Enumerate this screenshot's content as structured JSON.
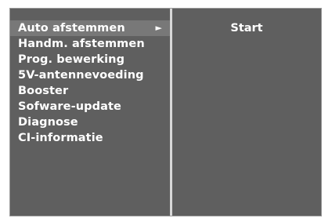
{
  "menu": {
    "items": [
      {
        "label": "Auto afstemmen",
        "selected": true
      },
      {
        "label": "Handm. afstemmen"
      },
      {
        "label": "Prog. bewerking"
      },
      {
        "label": "5V-antennevoeding"
      },
      {
        "label": "Booster"
      },
      {
        "label": "Sofware-update"
      },
      {
        "label": "Diagnose"
      },
      {
        "label": "CI-informatie"
      }
    ],
    "submenu_arrow": "►"
  },
  "submenu": {
    "option": "Start"
  },
  "colors": {
    "panel_background": "#5f5f5f",
    "selected_highlight": "#787878",
    "divider": "#d8d8d8",
    "text": "#ffffff"
  },
  "icons": {
    "submenu_arrow": "right-triangle-arrow-icon"
  }
}
